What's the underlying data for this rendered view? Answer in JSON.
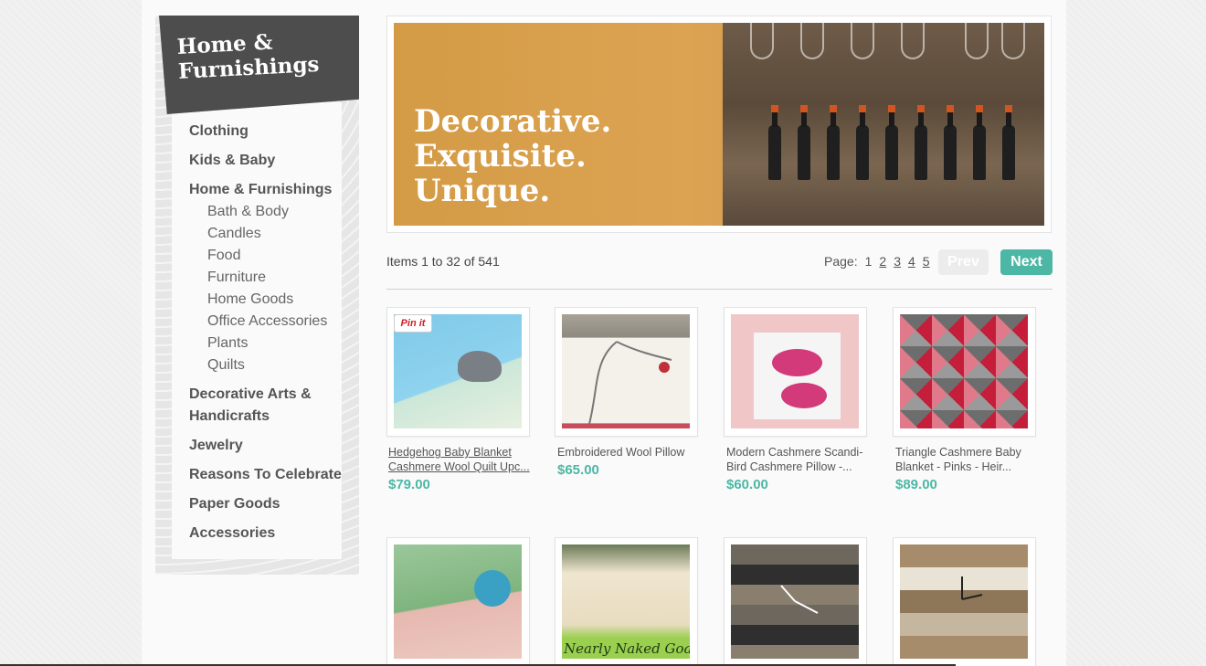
{
  "sidebar": {
    "title": "Home &\nFurnishings",
    "categories": [
      {
        "label": "Clothing"
      },
      {
        "label": "Kids & Baby"
      },
      {
        "label": "Home & Furnishings"
      },
      {
        "label": "Decorative Arts &"
      },
      {
        "label": "Handicrafts"
      },
      {
        "label": "Jewelry"
      },
      {
        "label": "Reasons To Celebrate"
      },
      {
        "label": "Paper Goods"
      },
      {
        "label": "Accessories"
      }
    ],
    "subcategories": [
      "Bath & Body",
      "Candles",
      "Food",
      "Furniture",
      "Home Goods",
      "Office Accessories",
      "Plants",
      "Quilts"
    ]
  },
  "banner": {
    "line1": "Decorative.",
    "line2": "Exquisite.",
    "line3": "Unique."
  },
  "listing": {
    "items_count": "Items 1 to 32 of 541",
    "page_label": "Page:",
    "pages": [
      "1",
      "2",
      "3",
      "4",
      "5"
    ],
    "current_page": "1",
    "prev_label": "Prev",
    "next_label": "Next"
  },
  "products": [
    {
      "title": "Hedgehog Baby Blanket Cashmere Wool Quilt Upc...",
      "price": "$79.00"
    },
    {
      "title": "Embroidered Wool Pillow",
      "price": "$65.00"
    },
    {
      "title": "Modern Cashmere Scandi-Bird Cashmere Pillow -...",
      "price": "$60.00"
    },
    {
      "title": "Triangle Cashmere Baby Blanket - Pinks - Heir...",
      "price": "$89.00"
    }
  ],
  "pinit_label": "Pin it",
  "colors": {
    "accent": "#4db7a5",
    "header_bg": "#4d4d4d",
    "banner_bg": "#d49b45"
  }
}
